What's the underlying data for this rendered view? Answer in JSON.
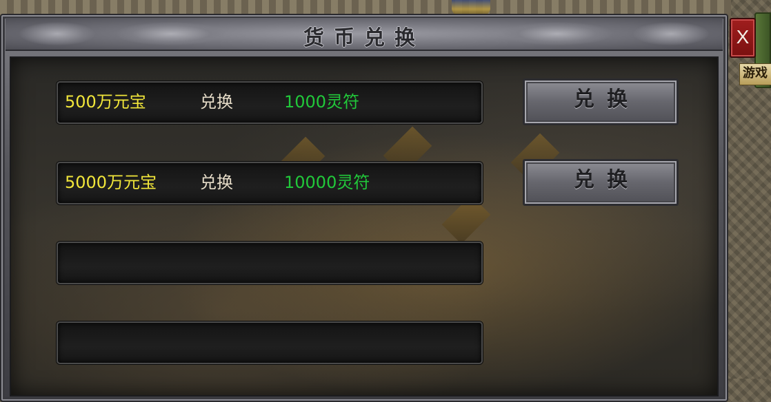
{
  "window": {
    "title": "货币兑换",
    "close_label": "X"
  },
  "rows": [
    {
      "amount": "500万元宝",
      "verb": "兑换",
      "reward": "1000灵符",
      "amount_color": "#f1e63a",
      "reward_color": "#21c93a"
    },
    {
      "amount": "5000万元宝",
      "verb": "兑换",
      "reward": "10000灵符",
      "amount_color": "#f1e63a",
      "reward_color": "#21c93a"
    },
    {
      "amount": "",
      "verb": "",
      "reward": ""
    },
    {
      "amount": "",
      "verb": "",
      "reward": ""
    }
  ],
  "buttons": [
    {
      "label": "兑换"
    },
    {
      "label": "兑换"
    }
  ],
  "side_panel": {
    "label": "游戏"
  }
}
